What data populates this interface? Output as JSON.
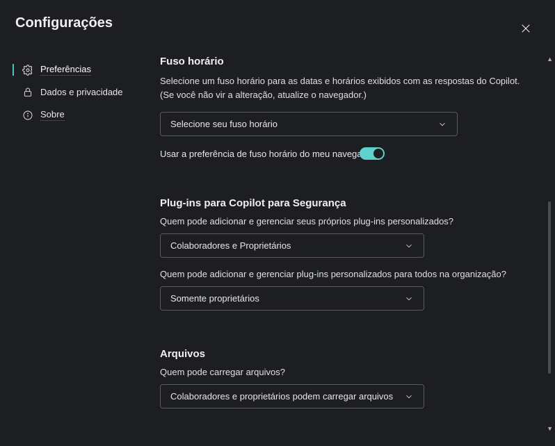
{
  "header": {
    "title": "Configurações"
  },
  "sidebar": {
    "items": [
      {
        "label": "Preferências"
      },
      {
        "label": "Dados e privacidade"
      },
      {
        "label": "Sobre"
      }
    ]
  },
  "timezone": {
    "title": "Fuso horário",
    "description": "Selecione um fuso horário para as datas e horários exibidos com as respostas do Copilot. (Se você não vir a alteração, atualize o navegador.)",
    "select_placeholder": "Selecione seu fuso horário",
    "toggle_label": "Usar a preferência de fuso horário do meu navegador"
  },
  "plugins": {
    "title": "Plug-ins para Copilot para Segurança",
    "q1": "Quem pode adicionar e gerenciar seus próprios plug-ins personalizados?",
    "q1_value": "Colaboradores e Proprietários",
    "q2": "Quem pode adicionar e gerenciar plug-ins personalizados para todos na organização?",
    "q2_value": "Somente proprietários"
  },
  "files": {
    "title": "Arquivos",
    "q1": "Quem pode carregar arquivos?",
    "q1_value": "Colaboradores e proprietários podem carregar arquivos"
  }
}
